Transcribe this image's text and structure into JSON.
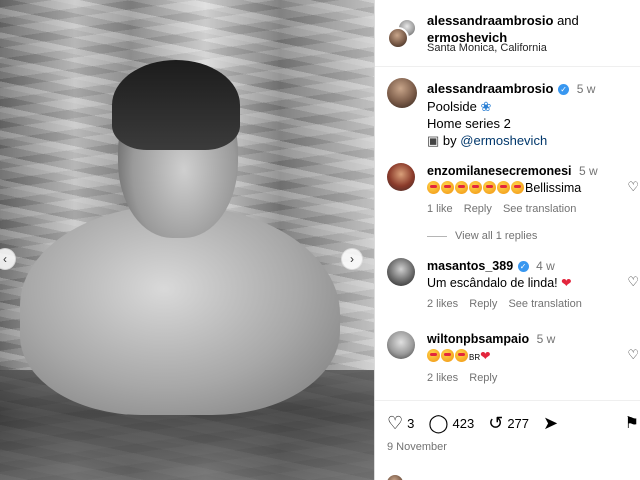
{
  "photo": {
    "nav_prev_icon": "chevron-left-icon",
    "nav_next_icon": "chevron-right-icon"
  },
  "header": {
    "user1": "alessandraambrosio",
    "and_text": "and",
    "user2": "ermoshevich",
    "location": "Santa Monica, California"
  },
  "caption": {
    "username": "alessandraambrosio",
    "time": "5 w",
    "line1": "Poolside",
    "line2": "Home series 2",
    "by_text": "by",
    "mention": "@ermoshevich"
  },
  "comments": [
    {
      "username": "enzomilanesecremonesi",
      "time": "5 w",
      "text": "Bellissima",
      "emoji_count": 7,
      "likes": "1 like",
      "reply": "Reply",
      "translate": "See translation"
    },
    {
      "username": "masantos_389",
      "time": "4 w",
      "text": "Um escândalo de linda!",
      "likes": "2 likes",
      "reply": "Reply",
      "translate": "See translation"
    },
    {
      "username": "wiltonpbsampaio",
      "time": "5 w",
      "text": "BR",
      "likes": "2 likes",
      "reply": "Reply"
    }
  ],
  "view_replies": "View all 1 replies",
  "actions": {
    "likes": "3",
    "comments": "423",
    "reposts": "277",
    "date": "9 November"
  }
}
